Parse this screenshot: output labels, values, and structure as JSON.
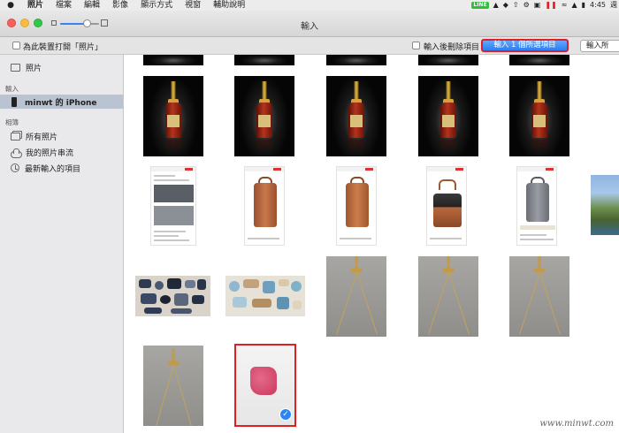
{
  "menubar": {
    "app_name": "照片",
    "items": [
      "檔案",
      "編輯",
      "影像",
      "顯示方式",
      "視窗",
      "輔助說明"
    ],
    "tray_line": "LINE",
    "clock": "4:45",
    "day": "週"
  },
  "window": {
    "title": "輸入"
  },
  "importbar": {
    "open_photos_label": "為此裝置打開「照片」",
    "delete_after_label": "輸入後刪除項目",
    "import_selected_label": "輸入 1 個所選項目",
    "import_all_label": "輸入所"
  },
  "sidebar": {
    "photos_label": "照片",
    "import_header": "輸入",
    "device_label": "minwt 的 iPhone",
    "albums_header": "相簿",
    "all_photos_label": "所有照片",
    "photo_stream_label": "我的照片串流",
    "last_import_label": "最新輸入的項目"
  },
  "grid": {
    "selected_count": 1
  },
  "watermark": "www.minwt.com",
  "colors": {
    "accent": "#2c7df5",
    "highlight_red": "#e02020",
    "sidebar_selected": "#b9c3d1"
  }
}
